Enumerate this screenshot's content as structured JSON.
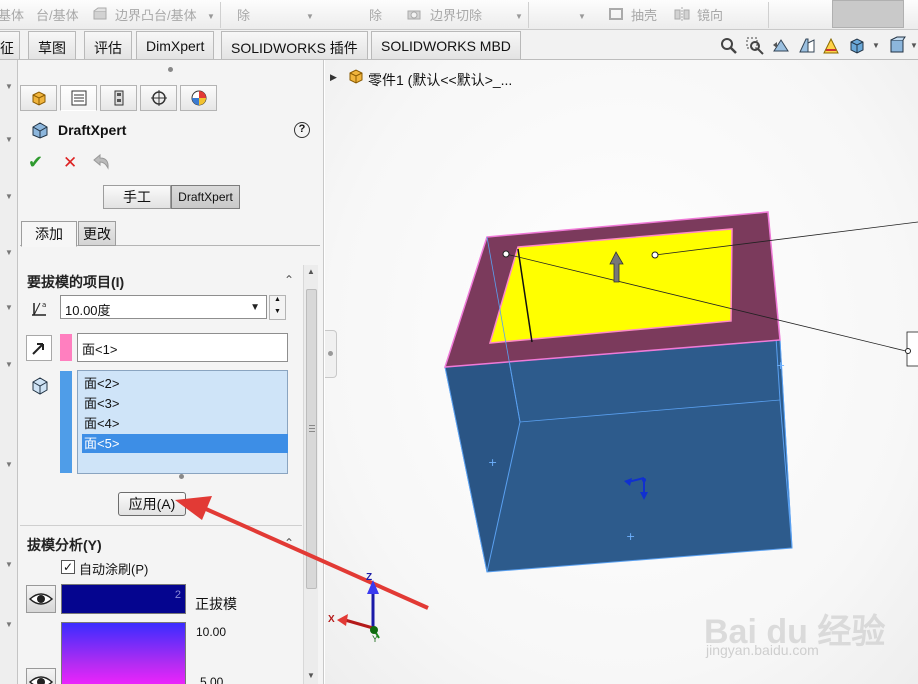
{
  "ribbon": {
    "items": [
      "基体",
      "台/基体",
      "边界凸台/基体",
      "除",
      "除",
      "边界切除",
      "抽壳",
      "镜向"
    ]
  },
  "tabs": [
    "征",
    "草图",
    "评估",
    "DimXpert",
    "SOLIDWORKS 插件",
    "SOLIDWORKS MBD"
  ],
  "property_manager": {
    "title": "DraftXpert",
    "help": "?",
    "mode_buttons": {
      "manual": "手工",
      "draftxpert": "DraftXpert"
    },
    "sub_tabs": {
      "add": "添加",
      "change": "更改"
    },
    "items_section": {
      "header": "要拔模的项目(I)",
      "angle": "10.00度",
      "neutral_face": "面<1>",
      "faces": [
        "面<2>",
        "面<3>",
        "面<4>",
        "面<5>"
      ],
      "selected_face_index": 3
    },
    "apply_label": "应用(A)",
    "analysis_section": {
      "header": "拔模分析(Y)",
      "auto_paint_label": "自动涂刷(P)",
      "auto_paint_checked": true,
      "positive_draft_label": "正拔模",
      "swatch_number": "2",
      "scale_top": "10.00",
      "scale_mid": "5.00"
    }
  },
  "viewport": {
    "tree_label": "零件1 (默认<<默认>_...",
    "axes": {
      "z": "Z",
      "x": "X",
      "y": "Y"
    },
    "colors": {
      "box_blue": "#2e5a8a",
      "rim_maroon": "#7a3a5a",
      "top_yellow": "#ffff00",
      "arrow_red": "#e23a35"
    }
  },
  "watermark": {
    "brand": "Bai du 经验",
    "url": "jingyan.baidu.com"
  }
}
